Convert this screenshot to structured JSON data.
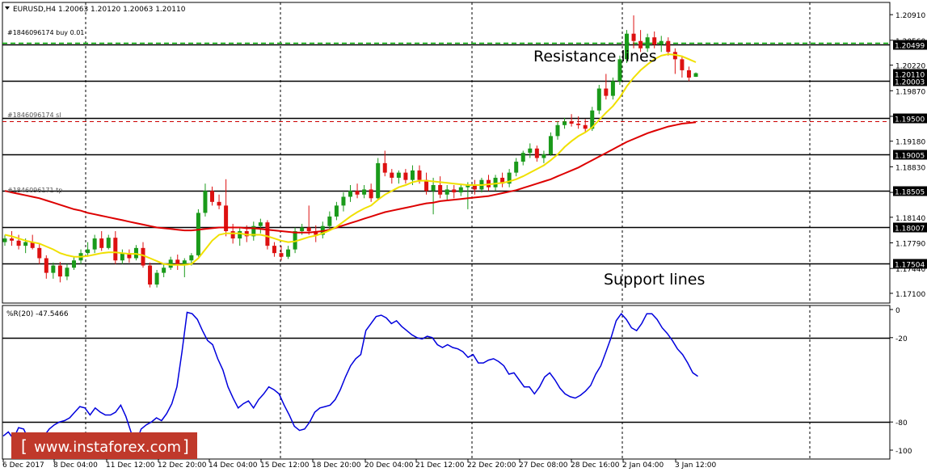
{
  "header": {
    "symbol_line": "EURUSD,H4  1.20063 1.20120 1.20063 1.20110"
  },
  "orders": {
    "buy": "#1846096174 buy 0.01",
    "sl": "#1846096174 sl",
    "tp": "#1846096171 tp"
  },
  "annotations": {
    "resistance": "Resistance lines",
    "support": "Support lines"
  },
  "watermark": "www.instaforex.com",
  "colors": {
    "bull": "#1a9a1a",
    "bear": "#dd1111",
    "ma_fast": "#f0e000",
    "ma_slow": "#dd0000",
    "wpr": "#0000dd",
    "order_line": "#00aa00",
    "sl_line": "#cc0000",
    "watermark_bg": "#c0392b"
  },
  "chart_data": [
    {
      "type": "candlestick",
      "symbol": "EURUSD",
      "timeframe": "H4",
      "ohlc_last": {
        "open": 1.20063,
        "high": 1.2012,
        "low": 1.20063,
        "close": 1.2011
      },
      "ylim": [
        1.17,
        1.21
      ],
      "y_ticks": [
        "1.20910",
        "1.20560",
        "1.20220",
        "1.19870",
        "1.19520",
        "1.19180",
        "1.18830",
        "1.18480",
        "1.18140",
        "1.17790",
        "1.17440",
        "1.17100"
      ],
      "x_ticks": [
        "6 Dec 2017",
        "8 Dec 04:00",
        "11 Dec 12:00",
        "12 Dec 20:00",
        "14 Dec 04:00",
        "15 Dec 12:00",
        "18 Dec 20:00",
        "20 Dec 04:00",
        "21 Dec 12:00",
        "22 Dec 20:00",
        "27 Dec 08:00",
        "28 Dec 16:00",
        "2 Jan 04:00",
        "3 Jan 12:00"
      ],
      "horizontal_levels": [
        {
          "value": 1.20499,
          "label": "1.20499",
          "kind": "resistance"
        },
        {
          "value": 1.20003,
          "label": "1.20003",
          "kind": "resistance"
        },
        {
          "value": 1.195,
          "label": "1.19500",
          "kind": "resistance"
        },
        {
          "value": 1.19005,
          "label": "1.19005",
          "kind": "support"
        },
        {
          "value": 1.18505,
          "label": "1.18505",
          "kind": "support"
        },
        {
          "value": 1.18007,
          "label": "1.18007",
          "kind": "support"
        },
        {
          "value": 1.17504,
          "label": "1.17504",
          "kind": "support"
        }
      ],
      "price_tags": [
        {
          "value": 1.2011,
          "label": "1.20110"
        }
      ],
      "order_levels": [
        {
          "value": 1.2052,
          "style": "green-dashed",
          "label_key": "buy"
        },
        {
          "value": 1.1945,
          "style": "red-dashed",
          "label_key": "sl"
        }
      ],
      "candles": [
        [
          1.178,
          1.179,
          1.1775,
          1.1785
        ],
        [
          1.1785,
          1.1795,
          1.1775,
          1.1782
        ],
        [
          1.1782,
          1.179,
          1.177,
          1.1775
        ],
        [
          1.1775,
          1.1785,
          1.1765,
          1.178
        ],
        [
          1.178,
          1.179,
          1.177,
          1.1772
        ],
        [
          1.1772,
          1.1778,
          1.175,
          1.1758
        ],
        [
          1.1758,
          1.1762,
          1.173,
          1.1738
        ],
        [
          1.1738,
          1.1752,
          1.173,
          1.1748
        ],
        [
          1.1748,
          1.1753,
          1.1725,
          1.1733
        ],
        [
          1.1733,
          1.175,
          1.1728,
          1.1745
        ],
        [
          1.1745,
          1.176,
          1.1742,
          1.1755
        ],
        [
          1.1755,
          1.177,
          1.175,
          1.1765
        ],
        [
          1.1765,
          1.178,
          1.176,
          1.177
        ],
        [
          1.177,
          1.179,
          1.1765,
          1.1785
        ],
        [
          1.1785,
          1.1795,
          1.1768,
          1.1772
        ],
        [
          1.1772,
          1.179,
          1.177,
          1.1786
        ],
        [
          1.1786,
          1.1795,
          1.175,
          1.1755
        ],
        [
          1.1755,
          1.177,
          1.175,
          1.1765
        ],
        [
          1.1765,
          1.177,
          1.1752,
          1.1758
        ],
        [
          1.1758,
          1.1776,
          1.1755,
          1.1772
        ],
        [
          1.1772,
          1.178,
          1.1745,
          1.1748
        ],
        [
          1.1748,
          1.1752,
          1.1718,
          1.1722
        ],
        [
          1.1722,
          1.1742,
          1.1718,
          1.1738
        ],
        [
          1.1738,
          1.175,
          1.1732,
          1.1745
        ],
        [
          1.1745,
          1.176,
          1.1742,
          1.1756
        ],
        [
          1.1756,
          1.1763,
          1.1742,
          1.175
        ],
        [
          1.175,
          1.1758,
          1.1732,
          1.1755
        ],
        [
          1.1755,
          1.1765,
          1.1748,
          1.1762
        ],
        [
          1.1762,
          1.1825,
          1.176,
          1.182
        ],
        [
          1.182,
          1.186,
          1.1815,
          1.185
        ],
        [
          1.185,
          1.1856,
          1.183,
          1.1835
        ],
        [
          1.1835,
          1.1845,
          1.1825,
          1.183
        ],
        [
          1.183,
          1.1866,
          1.1788,
          1.1795
        ],
        [
          1.1795,
          1.1805,
          1.1778,
          1.1785
        ],
        [
          1.1785,
          1.18,
          1.1775,
          1.1795
        ],
        [
          1.1795,
          1.1803,
          1.178,
          1.1788
        ],
        [
          1.1788,
          1.1808,
          1.1782,
          1.1802
        ],
        [
          1.1802,
          1.1812,
          1.1792,
          1.1807
        ],
        [
          1.1807,
          1.181,
          1.177,
          1.1775
        ],
        [
          1.1775,
          1.178,
          1.176,
          1.1765
        ],
        [
          1.1765,
          1.1775,
          1.1755,
          1.176
        ],
        [
          1.176,
          1.1775,
          1.1757,
          1.177
        ],
        [
          1.177,
          1.18,
          1.1765,
          1.1795
        ],
        [
          1.1795,
          1.1805,
          1.179,
          1.18
        ],
        [
          1.18,
          1.183,
          1.179,
          1.1795
        ],
        [
          1.1795,
          1.1803,
          1.178,
          1.179
        ],
        [
          1.179,
          1.1808,
          1.1785,
          1.1802
        ],
        [
          1.1802,
          1.1822,
          1.1798,
          1.1815
        ],
        [
          1.1815,
          1.1835,
          1.181,
          1.183
        ],
        [
          1.183,
          1.1848,
          1.1822,
          1.1842
        ],
        [
          1.1842,
          1.1858,
          1.1835,
          1.185
        ],
        [
          1.185,
          1.186,
          1.184,
          1.1845
        ],
        [
          1.1845,
          1.1858,
          1.184,
          1.1852
        ],
        [
          1.1852,
          1.186,
          1.1835,
          1.184
        ],
        [
          1.184,
          1.1895,
          1.1838,
          1.1888
        ],
        [
          1.1888,
          1.1905,
          1.187,
          1.1875
        ],
        [
          1.1875,
          1.188,
          1.186,
          1.1868
        ],
        [
          1.1868,
          1.1878,
          1.186,
          1.1875
        ],
        [
          1.1875,
          1.188,
          1.186,
          1.1865
        ],
        [
          1.1865,
          1.1885,
          1.1858,
          1.1878
        ],
        [
          1.1878,
          1.1885,
          1.186,
          1.1865
        ],
        [
          1.1865,
          1.1875,
          1.1845,
          1.185
        ],
        [
          1.185,
          1.1868,
          1.1818,
          1.1858
        ],
        [
          1.1858,
          1.187,
          1.184,
          1.1845
        ],
        [
          1.1845,
          1.1858,
          1.1838,
          1.1852
        ],
        [
          1.1852,
          1.1858,
          1.184,
          1.1848
        ],
        [
          1.1848,
          1.186,
          1.1843,
          1.1855
        ],
        [
          1.1855,
          1.1862,
          1.1825,
          1.1858
        ],
        [
          1.1858,
          1.1865,
          1.1845,
          1.1852
        ],
        [
          1.1852,
          1.1868,
          1.1848,
          1.1865
        ],
        [
          1.1865,
          1.1872,
          1.185,
          1.1855
        ],
        [
          1.1855,
          1.1872,
          1.185,
          1.1868
        ],
        [
          1.1868,
          1.1875,
          1.1855,
          1.186
        ],
        [
          1.186,
          1.188,
          1.1855,
          1.1875
        ],
        [
          1.1875,
          1.1895,
          1.187,
          1.189
        ],
        [
          1.189,
          1.1905,
          1.1885,
          1.1902
        ],
        [
          1.1902,
          1.1915,
          1.1895,
          1.1908
        ],
        [
          1.1908,
          1.1912,
          1.189,
          1.1895
        ],
        [
          1.1895,
          1.1905,
          1.1888,
          1.19
        ],
        [
          1.19,
          1.193,
          1.1898,
          1.1925
        ],
        [
          1.1925,
          1.1945,
          1.192,
          1.194
        ],
        [
          1.194,
          1.195,
          1.1935,
          1.1945
        ],
        [
          1.1945,
          1.1955,
          1.1938,
          1.1942
        ],
        [
          1.1942,
          1.1952,
          1.1935,
          1.194
        ],
        [
          1.194,
          1.1948,
          1.193,
          1.1935
        ],
        [
          1.1935,
          1.1965,
          1.1932,
          1.196
        ],
        [
          1.196,
          1.1995,
          1.1955,
          1.199
        ],
        [
          1.199,
          1.201,
          1.1975,
          1.198
        ],
        [
          1.198,
          1.2005,
          1.1975,
          1.2
        ],
        [
          1.2,
          1.2035,
          1.1995,
          1.203
        ],
        [
          1.203,
          1.207,
          1.2025,
          1.2065
        ],
        [
          1.2065,
          1.209,
          1.2045,
          1.2055
        ],
        [
          1.2055,
          1.207,
          1.204,
          1.2045
        ],
        [
          1.2045,
          1.2065,
          1.204,
          1.206
        ],
        [
          1.206,
          1.2068,
          1.2045,
          1.205
        ],
        [
          1.205,
          1.2062,
          1.204,
          1.2055
        ],
        [
          1.2055,
          1.206,
          1.2035,
          1.204
        ],
        [
          1.204,
          1.2045,
          1.201,
          1.203
        ],
        [
          1.203,
          1.2035,
          1.2005,
          1.2015
        ],
        [
          1.2015,
          1.202,
          1.2,
          1.2005
        ],
        [
          1.2006,
          1.2012,
          1.2006,
          1.2011
        ]
      ],
      "series": [
        {
          "name": "fast MA",
          "values": [
            1.179,
            1.1788,
            1.1785,
            1.1782,
            1.178,
            1.1778,
            1.1774,
            1.177,
            1.1765,
            1.1762,
            1.176,
            1.176,
            1.1761,
            1.1763,
            1.1765,
            1.1766,
            1.1766,
            1.1765,
            1.1764,
            1.1764,
            1.1762,
            1.1758,
            1.1754,
            1.175,
            1.1749,
            1.1749,
            1.1749,
            1.175,
            1.1758,
            1.177,
            1.1782,
            1.179,
            1.1792,
            1.1792,
            1.1792,
            1.179,
            1.179,
            1.179,
            1.1788,
            1.1785,
            1.1782,
            1.178,
            1.1781,
            1.1784,
            1.1787,
            1.1789,
            1.1792,
            1.1796,
            1.1801,
            1.1808,
            1.1815,
            1.1821,
            1.1826,
            1.183,
            1.1838,
            1.1845,
            1.185,
            1.1855,
            1.1858,
            1.1862,
            1.1864,
            1.1864,
            1.1863,
            1.1862,
            1.1861,
            1.186,
            1.1859,
            1.1858,
            1.1858,
            1.1858,
            1.1859,
            1.186,
            1.1861,
            1.1863,
            1.1866,
            1.187,
            1.1875,
            1.188,
            1.1885,
            1.1892,
            1.19,
            1.191,
            1.1918,
            1.1925,
            1.193,
            1.1937,
            1.1947,
            1.1957,
            1.1966,
            1.1978,
            1.1993,
            1.2005,
            1.2015,
            1.2023,
            1.203,
            1.2035,
            1.2037,
            1.2036,
            1.2034,
            1.203,
            1.2026
          ]
        },
        {
          "name": "slow MA",
          "values": [
            1.185,
            1.1848,
            1.1846,
            1.1844,
            1.1842,
            1.184,
            1.1837,
            1.1834,
            1.1831,
            1.1828,
            1.1825,
            1.1823,
            1.182,
            1.1818,
            1.1816,
            1.1814,
            1.1812,
            1.181,
            1.1808,
            1.1806,
            1.1804,
            1.1802,
            1.18,
            1.1799,
            1.1798,
            1.1797,
            1.1796,
            1.1796,
            1.1797,
            1.1798,
            1.1799,
            1.18,
            1.18,
            1.18,
            1.18,
            1.1799,
            1.1799,
            1.1798,
            1.1797,
            1.1796,
            1.1795,
            1.1794,
            1.1793,
            1.1793,
            1.1793,
            1.1794,
            1.1795,
            1.1797,
            1.18,
            1.1803,
            1.1806,
            1.1809,
            1.1812,
            1.1815,
            1.1818,
            1.1821,
            1.1823,
            1.1825,
            1.1827,
            1.1829,
            1.1831,
            1.1833,
            1.1834,
            1.1836,
            1.1837,
            1.1838,
            1.1839,
            1.184,
            1.1841,
            1.1842,
            1.1843,
            1.1845,
            1.1847,
            1.1849,
            1.1851,
            1.1854,
            1.1857,
            1.186,
            1.1863,
            1.1866,
            1.187,
            1.1874,
            1.1878,
            1.1882,
            1.1887,
            1.1892,
            1.1897,
            1.1902,
            1.1907,
            1.1912,
            1.1917,
            1.1921,
            1.1925,
            1.1929,
            1.1932,
            1.1935,
            1.1938,
            1.194,
            1.1942,
            1.1943,
            1.1944
          ]
        }
      ]
    },
    {
      "type": "line",
      "title": "%R(20) -47.5466",
      "ylim": [
        -100,
        0
      ],
      "y_ticks": [
        "0",
        "-20",
        "-80",
        "-100"
      ],
      "levels": [
        -20,
        -80
      ],
      "series": [
        {
          "name": "%R(20)",
          "values": [
            -90,
            -87,
            -92,
            -84,
            -85,
            -93,
            -98,
            -96,
            -90,
            -85,
            -82,
            -80,
            -79,
            -77,
            -73,
            -69,
            -70,
            -75,
            -70,
            -73,
            -75,
            -75,
            -73,
            -68,
            -76,
            -87,
            -95,
            -85,
            -82,
            -80,
            -77,
            -79,
            -74,
            -67,
            -55,
            -30,
            -2,
            -3,
            -7,
            -15,
            -22,
            -25,
            -35,
            -43,
            -55,
            -63,
            -70,
            -67,
            -65,
            -70,
            -64,
            -60,
            -55,
            -57,
            -60,
            -68,
            -75,
            -83,
            -86,
            -85,
            -80,
            -73,
            -70,
            -69,
            -68,
            -64,
            -57,
            -48,
            -40,
            -35,
            -32,
            -15,
            -10,
            -5,
            -4,
            -6,
            -10,
            -8,
            -12,
            -15,
            -18,
            -20,
            -21,
            -19,
            -20,
            -25,
            -27,
            -25,
            -27,
            -28,
            -30,
            -34,
            -32,
            -38,
            -38,
            -36,
            -35,
            -37,
            -40,
            -46,
            -45,
            -50,
            -55,
            -55,
            -60,
            -55,
            -48,
            -45,
            -50,
            -56,
            -60,
            -62,
            -63,
            -61,
            -58,
            -54,
            -46,
            -40,
            -30,
            -20,
            -8,
            -3,
            -7,
            -13,
            -15,
            -10,
            -3,
            -3,
            -7,
            -13,
            -17,
            -22,
            -28,
            -32,
            -38,
            -45,
            -47.5
          ]
        }
      ]
    }
  ]
}
